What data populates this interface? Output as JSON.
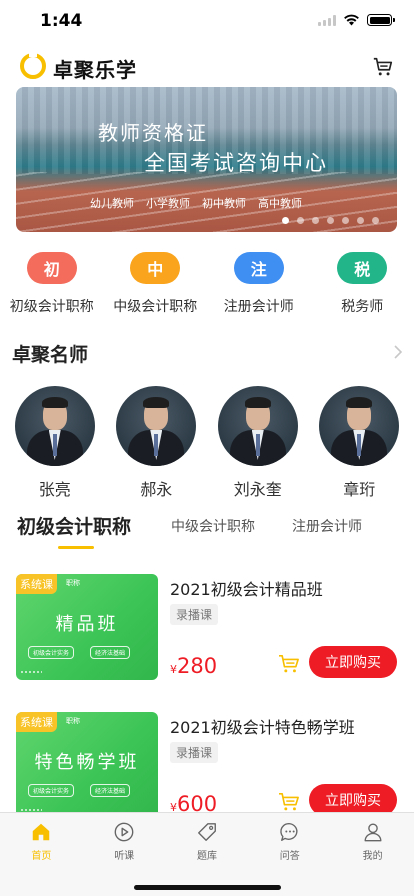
{
  "status_bar": {
    "time": "1:44",
    "battery_level": 1.0
  },
  "header": {
    "app_name": "卓聚乐学",
    "cart_icon": "cart-icon"
  },
  "banner": {
    "title_line1": "教师资格证",
    "title_line2": "全国考试咨询中心",
    "subtitles": [
      "幼儿教师",
      "小学教师",
      "初中教师",
      "高中教师"
    ],
    "dots_count": 7,
    "active_dot": 0
  },
  "categories": [
    {
      "badge": "初",
      "label": "初级会计职称",
      "color": "#f36c5c"
    },
    {
      "badge": "中",
      "label": "中级会计职称",
      "color": "#f9a41c"
    },
    {
      "badge": "注",
      "label": "注册会计师",
      "color": "#3f8ef2"
    },
    {
      "badge": "税",
      "label": "税务师",
      "color": "#22b58a"
    }
  ],
  "teachers_section": {
    "title": "卓聚名师"
  },
  "teachers": [
    {
      "name": "张亮"
    },
    {
      "name": "郝永"
    },
    {
      "name": "刘永奎"
    },
    {
      "name": "章珩"
    }
  ],
  "course_tabs": [
    {
      "label": "初级会计职称",
      "active": true
    },
    {
      "label": "中级会计职称",
      "active": false
    },
    {
      "label": "注册会计师",
      "active": false
    }
  ],
  "courses": [
    {
      "thumb_tag": "系统课",
      "thumb_level": "职称",
      "thumb_name": "精品班",
      "thumb_chips": [
        "初级会计实务",
        "经济法基础"
      ],
      "title": "2021初级会计精品班",
      "kind": "录播课",
      "currency": "¥",
      "price": "280",
      "buy_label": "立即购买"
    },
    {
      "thumb_tag": "系统课",
      "thumb_level": "职称",
      "thumb_name": "特色畅学班",
      "thumb_chips": [
        "初级会计实务",
        "经济法基础"
      ],
      "title": "2021初级会计特色畅学班",
      "kind": "录播课",
      "currency": "¥",
      "price": "600",
      "buy_label": "立即购买"
    }
  ],
  "tabbar": [
    {
      "label": "首页",
      "icon": "home-icon",
      "active": true
    },
    {
      "label": "听课",
      "icon": "play-icon",
      "active": false
    },
    {
      "label": "题库",
      "icon": "tag-icon",
      "active": false
    },
    {
      "label": "问答",
      "icon": "chat-icon",
      "active": false
    },
    {
      "label": "我的",
      "icon": "user-icon",
      "active": false
    }
  ],
  "colors": {
    "accent": "#f7bf00",
    "price_red": "#ee1c25",
    "card_green": "#3cc456"
  }
}
